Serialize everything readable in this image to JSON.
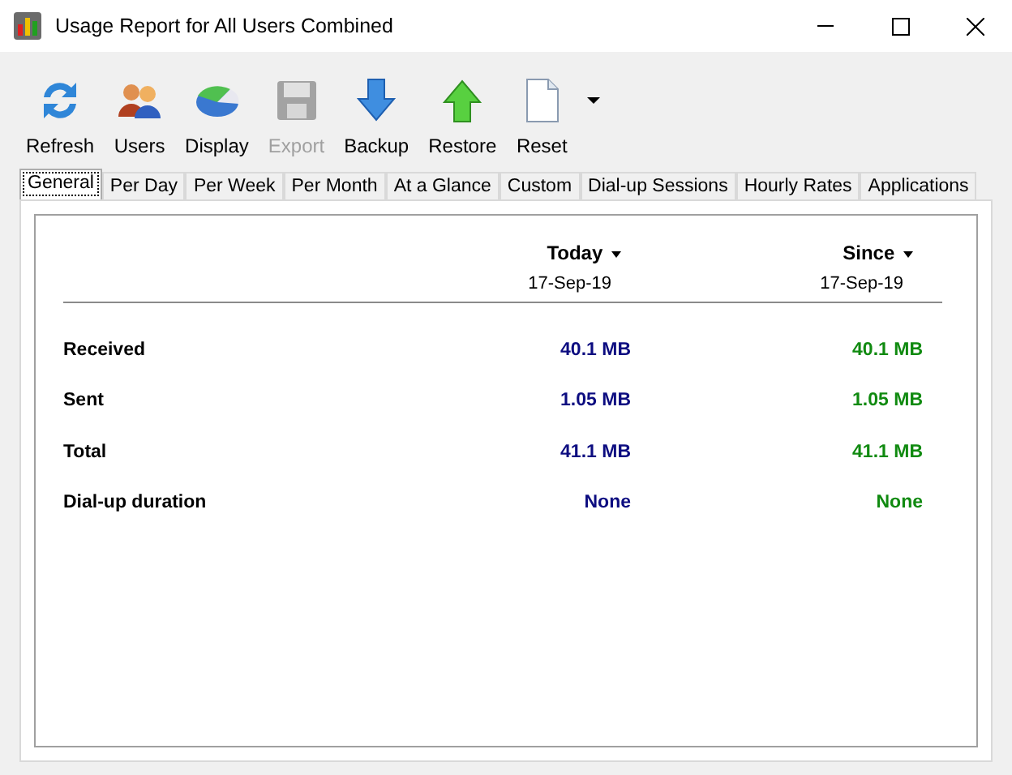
{
  "window": {
    "title": "Usage Report for All Users Combined"
  },
  "toolbar": [
    {
      "label": "Refresh",
      "disabled": false
    },
    {
      "label": "Users",
      "disabled": false
    },
    {
      "label": "Display",
      "disabled": false
    },
    {
      "label": "Export",
      "disabled": true
    },
    {
      "label": "Backup",
      "disabled": false
    },
    {
      "label": "Restore",
      "disabled": false
    },
    {
      "label": "Reset",
      "disabled": false,
      "dropdown": true
    }
  ],
  "tabs": [
    {
      "label": "General",
      "selected": true
    },
    {
      "label": "Per Day",
      "selected": false
    },
    {
      "label": "Per Week",
      "selected": false
    },
    {
      "label": "Per Month",
      "selected": false
    },
    {
      "label": "At a Glance",
      "selected": false
    },
    {
      "label": "Custom",
      "selected": false
    },
    {
      "label": "Dial-up Sessions",
      "selected": false
    },
    {
      "label": "Hourly Rates",
      "selected": false
    },
    {
      "label": "Applications",
      "selected": false
    }
  ],
  "report": {
    "columns": [
      {
        "title": "Today",
        "date": "17-Sep-19",
        "color": "#0c0c80"
      },
      {
        "title": "Since",
        "date": "17-Sep-19",
        "color": "#108a10"
      }
    ],
    "rows": [
      {
        "label": "Received",
        "values": [
          "40.1 MB",
          "40.1 MB"
        ]
      },
      {
        "label": "Sent",
        "values": [
          "1.05 MB",
          "1.05 MB"
        ]
      },
      {
        "label": "Total",
        "values": [
          "41.1 MB",
          "41.1 MB"
        ]
      },
      {
        "label": "Dial-up duration",
        "values": [
          "None",
          "None"
        ]
      }
    ]
  }
}
